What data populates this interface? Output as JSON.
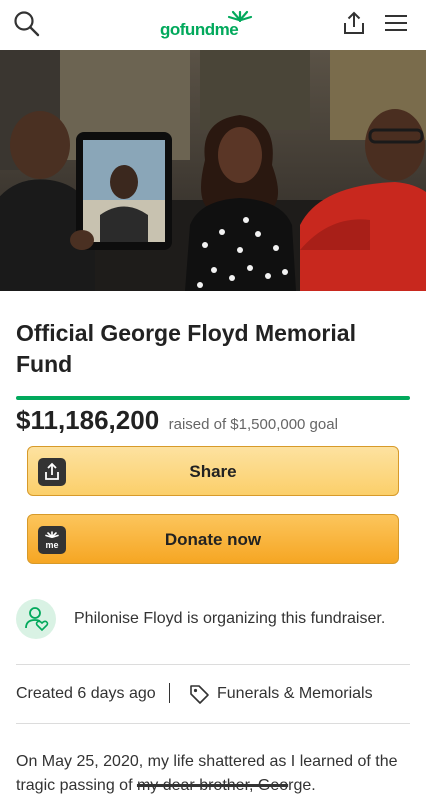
{
  "header": {
    "logo_text": "gofundme",
    "icons": {
      "search": "search-icon",
      "share": "share-icon",
      "menu": "hamburger-menu-icon"
    },
    "brand_color": "#02a95c"
  },
  "campaign": {
    "title": "Official George Floyd Memorial Fund",
    "progress_fraction": 1.0,
    "raised_amount": "$11,186,200",
    "raised_of": "raised of $1,500,000 goal"
  },
  "actions": {
    "share_label": "Share",
    "donate_label": "Donate now",
    "share_color": "#fbd27a",
    "donate_color": "#f8b03a",
    "donate_icon_text": "me"
  },
  "organizer": {
    "text": "Philonise Floyd is organizing this fundraiser."
  },
  "meta": {
    "created": "Created 6 days ago",
    "category": "Funerals & Memorials"
  },
  "story": {
    "text_before": "On May 25, 2020, my life shattered as I learned of the tragic passing of ",
    "struck_text": "my dear brother, Geo",
    "text_after": "rge."
  }
}
